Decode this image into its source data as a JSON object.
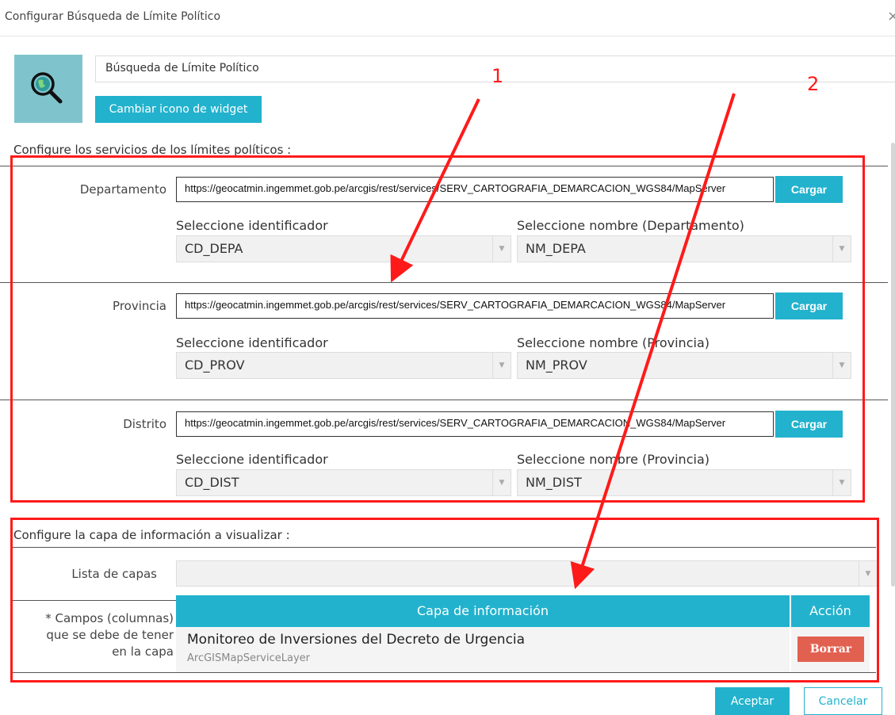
{
  "dialog": {
    "title": "Configurar Búsqueda de Límite Político",
    "close_glyph": "×"
  },
  "widget": {
    "name": "Búsqueda de Límite Político",
    "change_icon_label": "Cambiar icono de widget",
    "icon": "globe-magnifier-icon"
  },
  "services": {
    "section_label": "Configure los servicios de los límites políticos :",
    "rows": [
      {
        "label": "Departamento",
        "url": "https://geocatmin.ingemmet.gob.pe/arcgis/rest/services/SERV_CARTOGRAFIA_DEMARCACION_WGS84/MapServer",
        "load_label": "Cargar",
        "id_label": "Seleccione identificador",
        "id_value": "CD_DEPA",
        "name_label": "Seleccione nombre (Departamento)",
        "name_value": "NM_DEPA"
      },
      {
        "label": "Provincia",
        "url": "https://geocatmin.ingemmet.gob.pe/arcgis/rest/services/SERV_CARTOGRAFIA_DEMARCACION_WGS84/MapServer",
        "load_label": "Cargar",
        "id_label": "Seleccione identificador",
        "id_value": "CD_PROV",
        "name_label": "Seleccione nombre (Provincia)",
        "name_value": "NM_PROV"
      },
      {
        "label": "Distrito",
        "url": "https://geocatmin.ingemmet.gob.pe/arcgis/rest/services/SERV_CARTOGRAFIA_DEMARCACION_WGS84/MapServer",
        "load_label": "Cargar",
        "id_label": "Seleccione identificador",
        "id_value": "CD_DIST",
        "name_label": "Seleccione nombre (Provincia)",
        "name_value": "NM_DIST"
      }
    ]
  },
  "layers": {
    "section_label": "Configure la capa de información a visualizar :",
    "list_label": "Lista de capas",
    "list_value": "",
    "fields_note_1": "* Campos (columnas)",
    "fields_note_2": "que se debe de tener",
    "fields_note_3": "en la capa",
    "table": {
      "col_layer": "Capa de información",
      "col_action": "Acción",
      "rows": [
        {
          "name": "Monitoreo de Inversiones del Decreto de Urgencia",
          "type": "ArcGISMapServiceLayer",
          "action_label": "Borrar"
        }
      ]
    }
  },
  "footer": {
    "ok_label": "Aceptar",
    "cancel_label": "Cancelar"
  },
  "annotations": {
    "marker_1": "1",
    "marker_2": "2",
    "color": "#ff1a1a"
  },
  "colors": {
    "accent": "#22b2cd",
    "danger": "#e26050",
    "icon_bg": "#7fc4cc"
  }
}
